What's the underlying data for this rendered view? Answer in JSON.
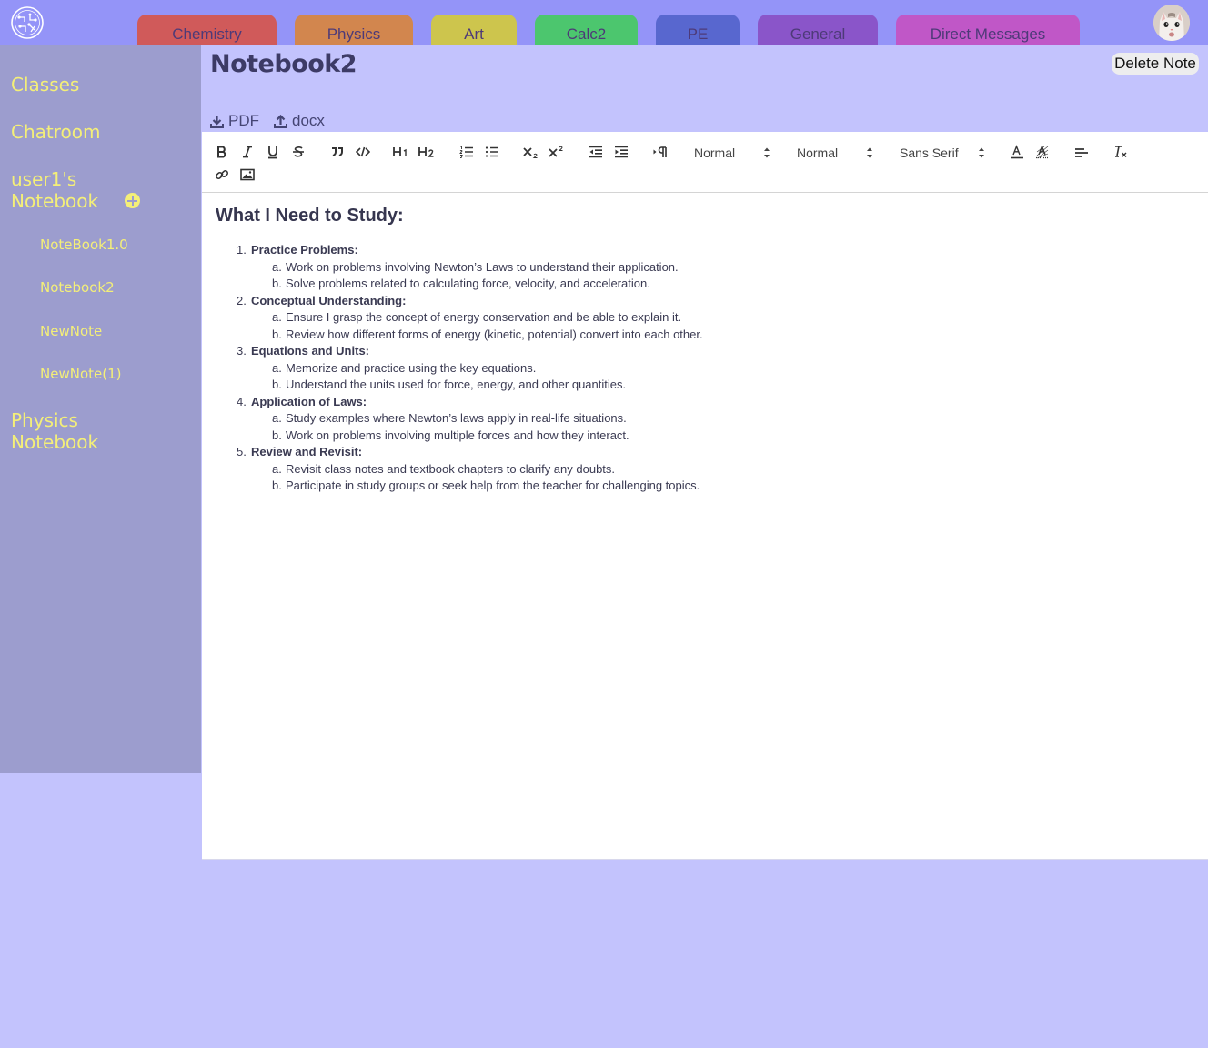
{
  "tabs": [
    {
      "label": "Chemistry",
      "color": "#d05a5a"
    },
    {
      "label": "Physics",
      "color": "#d2864e"
    },
    {
      "label": "Art",
      "color": "#cdc54d"
    },
    {
      "label": "Calc2",
      "color": "#4cc66e"
    },
    {
      "label": "PE",
      "color": "#5867cf"
    },
    {
      "label": "General",
      "color": "#8a55c9"
    },
    {
      "label": "Direct Messages",
      "color": "#c057c7"
    }
  ],
  "sidebar": {
    "classes": "Classes",
    "chatroom": "Chatroom",
    "notebook_line1": "user1's",
    "notebook_line2": "Notebook",
    "notes": [
      "NoteBook1.0",
      "Notebook2",
      "NewNote",
      "NewNote(1)"
    ],
    "physics_line1": "Physics",
    "physics_line2": "Notebook"
  },
  "note": {
    "title": "Notebook2",
    "delete_label": "Delete Note",
    "export_pdf": "PDF",
    "export_docx": "docx"
  },
  "toolbar": {
    "header_picker": "Normal",
    "size_picker": "Normal",
    "font_picker": "Sans Serif"
  },
  "content": {
    "heading": "What I Need to Study:",
    "items": [
      {
        "num": "1.",
        "title": "Practice Problems:",
        "subs": [
          {
            "num": "a.",
            "text": "Work on problems involving Newton’s Laws to understand their application."
          },
          {
            "num": "b.",
            "text": "Solve problems related to calculating force, velocity, and acceleration."
          }
        ]
      },
      {
        "num": "2.",
        "title": "Conceptual Understanding:",
        "subs": [
          {
            "num": "a.",
            "text": "Ensure I grasp the concept of energy conservation and be able to explain it."
          },
          {
            "num": "b.",
            "text": "Review how different forms of energy (kinetic, potential) convert into each other."
          }
        ]
      },
      {
        "num": "3.",
        "title": "Equations and Units:",
        "subs": [
          {
            "num": "a.",
            "text": "Memorize and practice using the key equations."
          },
          {
            "num": "b.",
            "text": "Understand the units used for force, energy, and other quantities."
          }
        ]
      },
      {
        "num": "4.",
        "title": "Application of Laws:",
        "subs": [
          {
            "num": "a.",
            "text": "Study examples where Newton’s laws apply in real-life situations."
          },
          {
            "num": "b.",
            "text": "Work on problems involving multiple forces and how they interact."
          }
        ]
      },
      {
        "num": "5.",
        "title": "Review and Revisit:",
        "subs": [
          {
            "num": "a.",
            "text": "Revisit class notes and textbook chapters to clarify any doubts."
          },
          {
            "num": "b.",
            "text": "Participate in study groups or seek help from the teacher for challenging topics."
          }
        ]
      }
    ]
  },
  "colors": {
    "topbar": "#9494f8",
    "sidebar": "#9c9dce",
    "page_bg": "#c3c3fd",
    "sidebar_text": "#f4ef78"
  }
}
